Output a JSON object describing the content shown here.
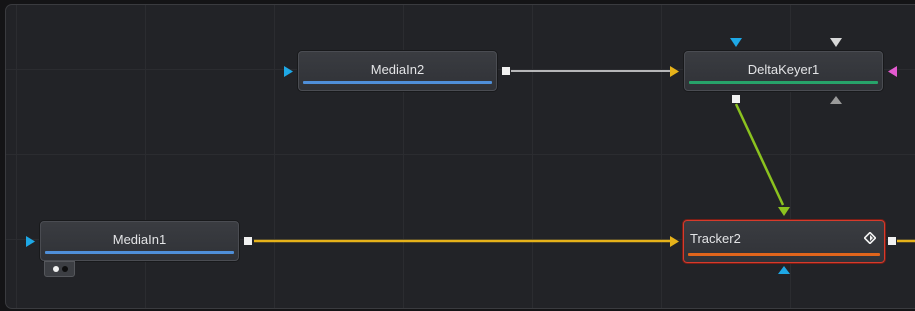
{
  "nodes": {
    "mediain2": {
      "label": "MediaIn2",
      "bar_color": "#4f8fd9"
    },
    "deltakeyer1": {
      "label": "DeltaKeyer1",
      "bar_color": "#27a36a"
    },
    "mediain1": {
      "label": "MediaIn1",
      "bar_color": "#4f8fd9"
    },
    "tracker2": {
      "label": "Tracker2",
      "bar_color": "#e0651c",
      "selected": true
    }
  },
  "links": {
    "mediain2_to_deltakeyer1": {
      "from": "MediaIn2",
      "to": "DeltaKeyer1",
      "color": "#e8e8e8"
    },
    "deltakeyer1_to_tracker2": {
      "from": "DeltaKeyer1",
      "to": "Tracker2",
      "color": "#8bc21f"
    },
    "mediain1_to_tracker2": {
      "from": "MediaIn1",
      "to": "Tracker2",
      "color": "#e6b21a"
    }
  },
  "colors": {
    "background_input": "#1ea8e6",
    "foreground_input": "#e6b21a",
    "effect_mask_input": "#e45ad0",
    "garbage_mask_input": "#d8d8d8",
    "clean_plate_input": "#9a9a9a",
    "output_port": "#f1f1f1"
  },
  "icons": {
    "keyframe": "keyframe-diamond-icon",
    "view_indicator": "viewer-dots-icon"
  }
}
